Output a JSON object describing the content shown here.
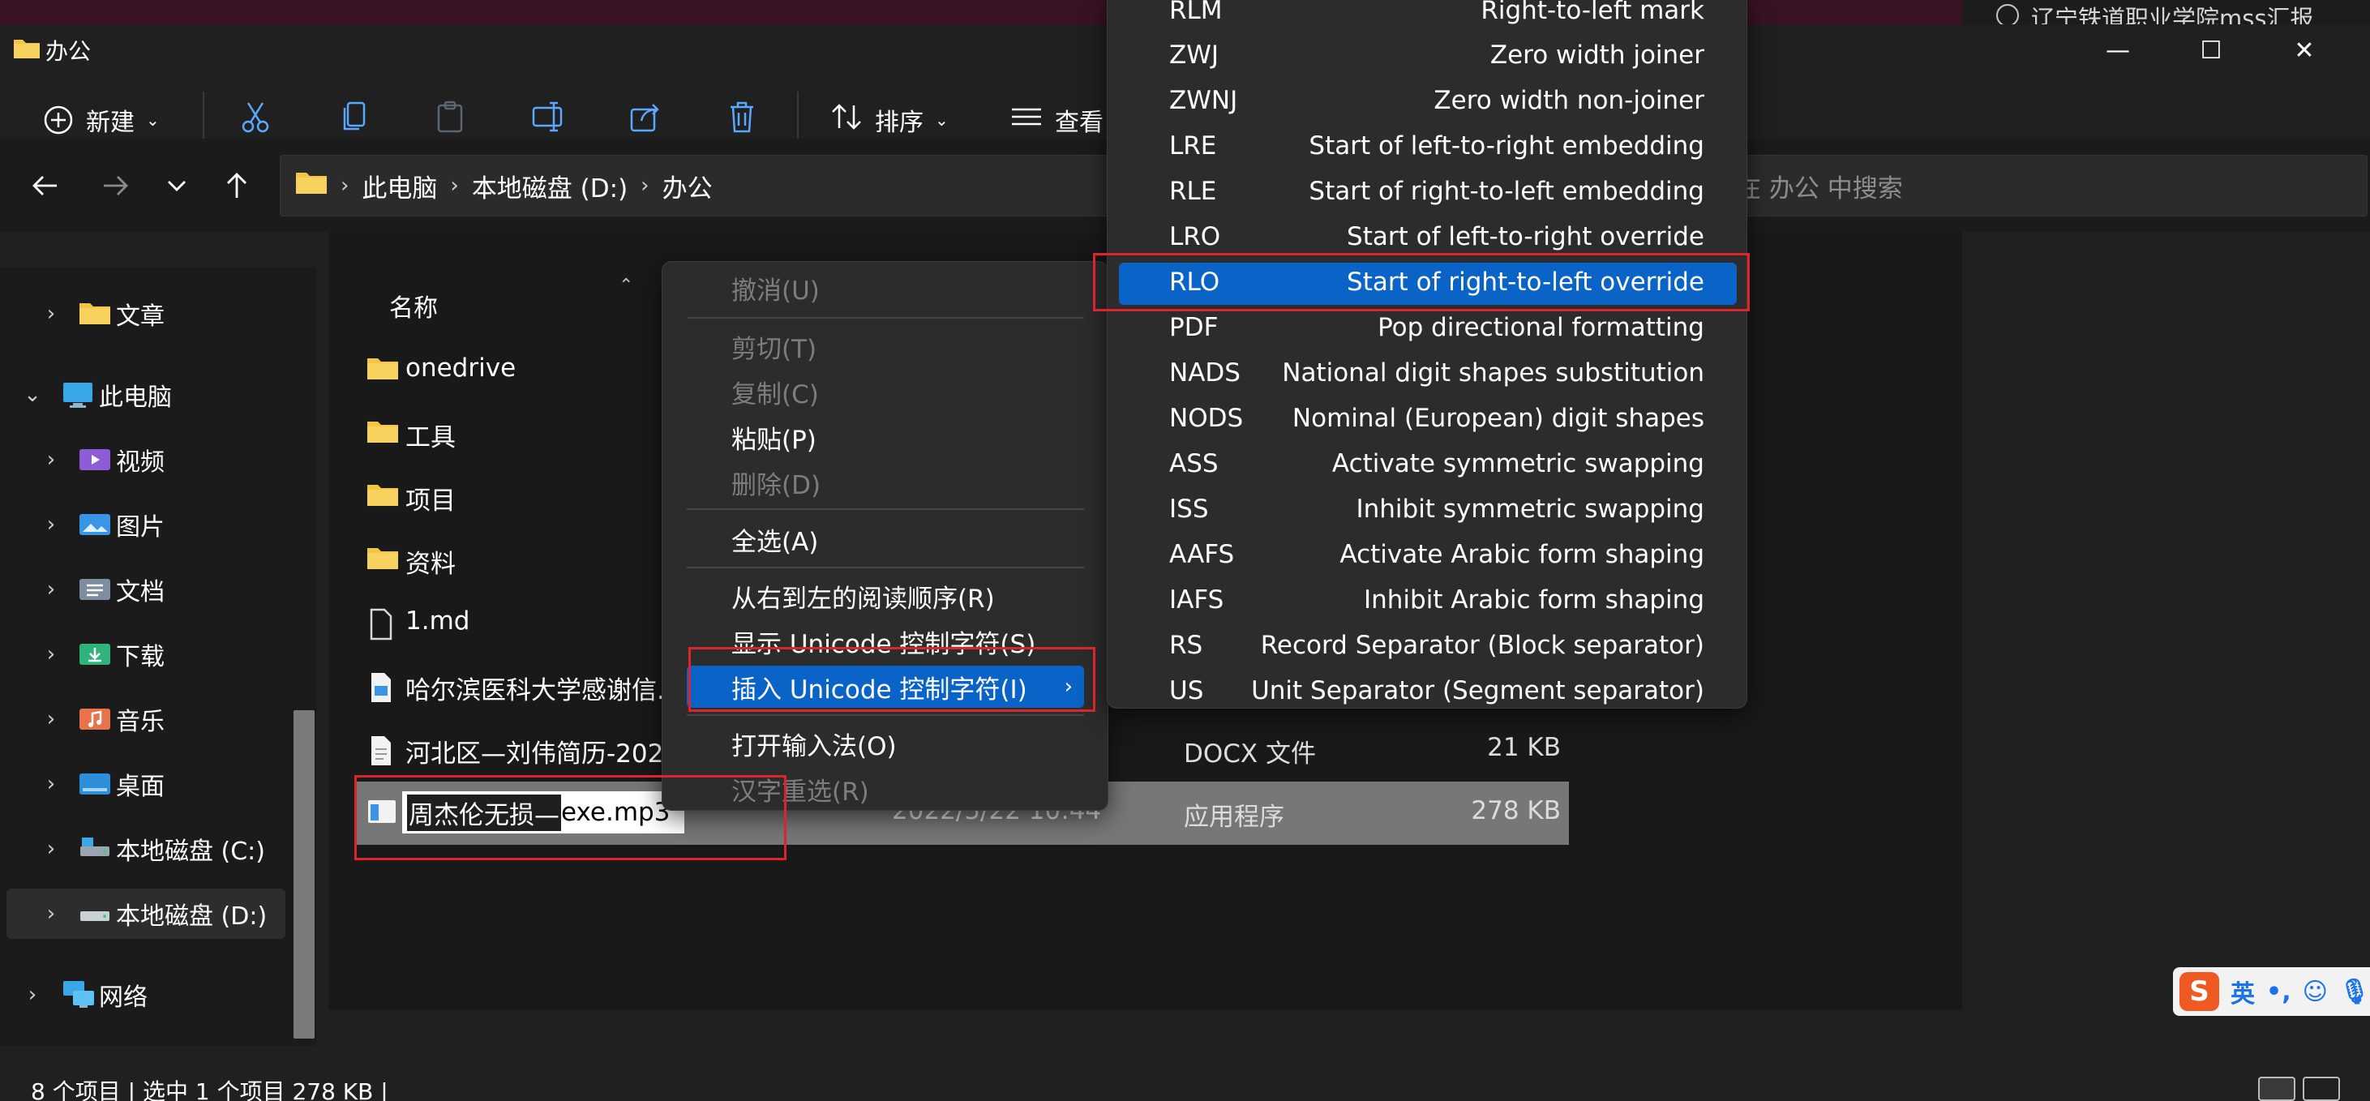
{
  "background": {
    "side_app_item": "辽宁铁道职业学院mss汇报"
  },
  "window": {
    "title": "办公",
    "controls": {
      "minimize": "—",
      "maximize": "☐",
      "close": "✕"
    }
  },
  "toolbar": {
    "new_label": "新建",
    "sort_label": "排序",
    "view_label": "查看"
  },
  "address": {
    "crumbs": [
      "此电脑",
      "本地磁盘 (D:)",
      "办公"
    ],
    "search_placeholder": "在 办公 中搜索"
  },
  "sidebar": {
    "items": [
      {
        "label": "文章"
      },
      {
        "label": "此电脑"
      },
      {
        "label": "视频"
      },
      {
        "label": "图片"
      },
      {
        "label": "文档"
      },
      {
        "label": "下载"
      },
      {
        "label": "音乐"
      },
      {
        "label": "桌面"
      },
      {
        "label": "本地磁盘 (C:)"
      },
      {
        "label": "本地磁盘 (D:)"
      },
      {
        "label": "网络"
      }
    ]
  },
  "files": {
    "column_name": "名称",
    "rows": [
      {
        "name": "onedrive",
        "date": "",
        "type": "",
        "size": ""
      },
      {
        "name": "工具",
        "date": "",
        "type": "",
        "size": ""
      },
      {
        "name": "项目",
        "date": "",
        "type": "",
        "size": ""
      },
      {
        "name": "资料",
        "date": "",
        "type": "",
        "size": ""
      },
      {
        "name": "1.md",
        "date": "",
        "type": "",
        "size": ""
      },
      {
        "name": "哈尔滨医科大学感谢信.p",
        "date": "",
        "type": "",
        "size": ""
      },
      {
        "name": "河北区—刘伟简历-2022",
        "date": "",
        "type": "DOCX 文件",
        "size": "21 KB"
      },
      {
        "name": "周杰伦无损—exe.mp3",
        "date": "2022/5/22 10:44",
        "type": "应用程序",
        "size": "278 KB"
      }
    ],
    "rename": {
      "selected_part": "周杰伦无损—",
      "rest": "exe.mp3"
    }
  },
  "status": {
    "text": "8 个项目  |  选中 1 个项目 278 KB  |"
  },
  "context_menu": {
    "items": [
      {
        "label": "撤消(U)"
      },
      {
        "label": "剪切(T)"
      },
      {
        "label": "复制(C)"
      },
      {
        "label": "粘贴(P)"
      },
      {
        "label": "删除(D)"
      },
      {
        "label": "全选(A)"
      },
      {
        "label": "从右到左的阅读顺序(R)"
      },
      {
        "label": "显示 Unicode 控制字符(S)"
      },
      {
        "label": "插入 Unicode 控制字符(I)"
      },
      {
        "label": "打开输入法(O)"
      },
      {
        "label": "汉字重选(R)"
      }
    ]
  },
  "unicode_submenu": {
    "items": [
      {
        "code": "RLM",
        "desc": "Right-to-left mark"
      },
      {
        "code": "ZWJ",
        "desc": "Zero width joiner"
      },
      {
        "code": "ZWNJ",
        "desc": "Zero width non-joiner"
      },
      {
        "code": "LRE",
        "desc": "Start of left-to-right embedding"
      },
      {
        "code": "RLE",
        "desc": "Start of right-to-left embedding"
      },
      {
        "code": "LRO",
        "desc": "Start of left-to-right override"
      },
      {
        "code": "RLO",
        "desc": "Start of right-to-left override"
      },
      {
        "code": "PDF",
        "desc": "Pop directional formatting"
      },
      {
        "code": "NADS",
        "desc": "National digit shapes substitution"
      },
      {
        "code": "NODS",
        "desc": "Nominal (European) digit shapes"
      },
      {
        "code": "ASS",
        "desc": "Activate symmetric swapping"
      },
      {
        "code": "ISS",
        "desc": "Inhibit symmetric swapping"
      },
      {
        "code": "AAFS",
        "desc": "Activate Arabic form shaping"
      },
      {
        "code": "IAFS",
        "desc": "Inhibit Arabic form shaping"
      },
      {
        "code": "RS",
        "desc": "Record Separator (Block separator)"
      },
      {
        "code": "US",
        "desc": "Unit Separator (Segment separator)"
      }
    ]
  },
  "ime": {
    "logo": "S",
    "mode": "英",
    "punct": "•,"
  },
  "colors": {
    "menu_highlight": "#0a64c8",
    "annotation_red": "#d9252b",
    "folder_yellow": "#f4c542"
  }
}
